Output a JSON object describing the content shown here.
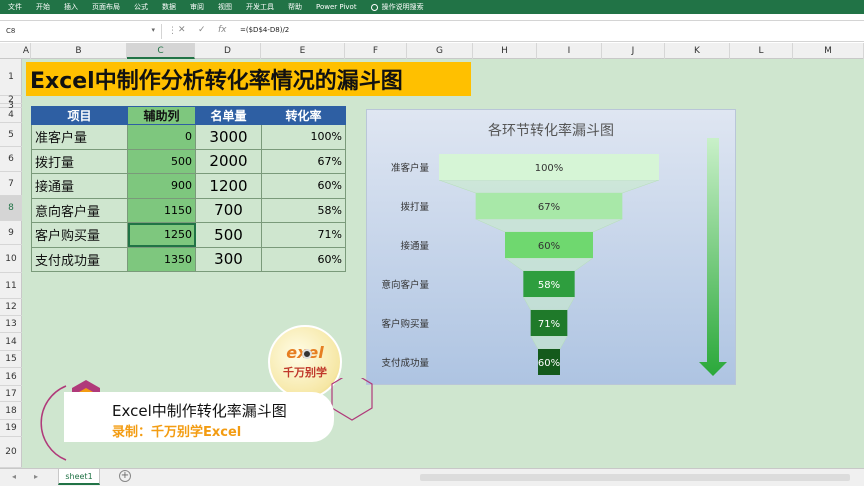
{
  "menu": {
    "items": [
      "文件",
      "开始",
      "插入",
      "页面布局",
      "公式",
      "数据",
      "审阅",
      "视图",
      "开发工具",
      "帮助",
      "Power Pivot"
    ],
    "tell_me": "操作说明搜索"
  },
  "formula_bar": {
    "name_box": "C8",
    "formula": "=($D$4-D8)/2"
  },
  "columns": [
    "A",
    "B",
    "C",
    "D",
    "E",
    "F",
    "G",
    "H",
    "I",
    "J",
    "K",
    "L",
    "M"
  ],
  "rows": [
    "1",
    "2",
    "3",
    "4",
    "5",
    "6",
    "7",
    "8",
    "9",
    "10",
    "11",
    "12",
    "13",
    "14",
    "15",
    "16",
    "17",
    "18",
    "19",
    "20"
  ],
  "banner_title": "Excel中制作分析转化率情况的漏斗图",
  "table": {
    "headers": [
      "项目",
      "辅助列",
      "名单量",
      "转化率"
    ],
    "rows": [
      {
        "name": "准客户量",
        "helper": "0",
        "orders": "3000",
        "rate": "100%"
      },
      {
        "name": "拨打量",
        "helper": "500",
        "orders": "2000",
        "rate": "67%"
      },
      {
        "name": "接通量",
        "helper": "900",
        "orders": "1200",
        "rate": "60%"
      },
      {
        "name": "意向客户量",
        "helper": "1150",
        "orders": "700",
        "rate": "58%"
      },
      {
        "name": "客户购买量",
        "helper": "1250",
        "orders": "500",
        "rate": "71%"
      },
      {
        "name": "支付成功量",
        "helper": "1350",
        "orders": "300",
        "rate": "60%"
      }
    ]
  },
  "chart_data": {
    "type": "bar",
    "title": "各环节转化率漏斗图",
    "categories": [
      "准客户量",
      "拨打量",
      "接通量",
      "意向客户量",
      "客户购买量",
      "支付成功量"
    ],
    "values": [
      3000,
      2000,
      1200,
      700,
      500,
      300
    ],
    "offsets": [
      0,
      500,
      900,
      1150,
      1250,
      1350
    ],
    "labels": [
      "100%",
      "67%",
      "60%",
      "58%",
      "71%",
      "60%"
    ],
    "colors": [
      "#d6f5d6",
      "#a8e8a8",
      "#6fd86f",
      "#2e9e3e",
      "#1f7a2a",
      "#145a1c"
    ],
    "max": 3000
  },
  "sheet": {
    "tab": "sheet1"
  },
  "overlay": {
    "title": "Excel中制作转化率漏斗图",
    "subtitle": "录制：千万别学Excel",
    "logo_line1": "exel",
    "logo_line2": "千万别学"
  }
}
